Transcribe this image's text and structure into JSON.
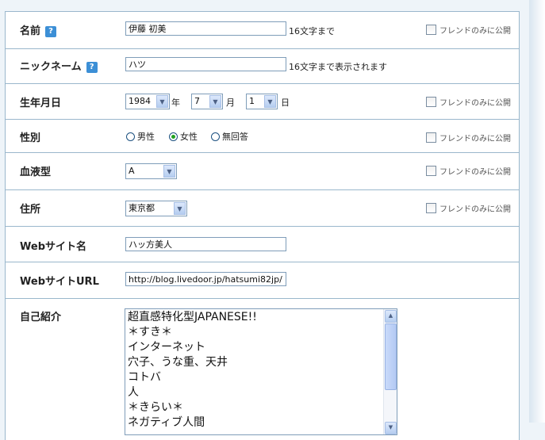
{
  "help_glyph": "?",
  "public_only": "フレンドのみに公開",
  "name": {
    "label": "名前",
    "value": "伊藤 初美",
    "note": "16文字まで"
  },
  "nickname": {
    "label": "ニックネーム",
    "value": "ハツ",
    "note": "16文字まで表示されます"
  },
  "birthday": {
    "label": "生年月日",
    "year": "1984",
    "year_unit": "年",
    "month": "7",
    "month_unit": "月",
    "day": "1",
    "day_unit": "日"
  },
  "gender": {
    "label": "性別",
    "options": [
      "男性",
      "女性",
      "無回答"
    ],
    "selected": "女性"
  },
  "blood_type": {
    "label": "血液型",
    "value": "A"
  },
  "address": {
    "label": "住所",
    "value": "東京都"
  },
  "website_name": {
    "label": "Webサイト名",
    "value": "ハッ方美人"
  },
  "website_url": {
    "label": "WebサイトURL",
    "value": "http://blog.livedoor.jp/hatsumi82jp/"
  },
  "intro": {
    "label": "自己紹介",
    "lines": [
      "超直感特化型JAPANESE!!",
      "＊すき＊",
      "インターネット",
      "穴子、うな重、天井",
      "コトバ",
      "人",
      "＊きらい＊",
      "ネガティブ人間"
    ]
  },
  "icons": {
    "help": "question-mark-icon",
    "checkbox": "checkbox-icon",
    "dropdown": "chevron-down-icon",
    "scroll_up": "scroll-up-icon",
    "scroll_down": "scroll-down-icon"
  },
  "colors": {
    "border": "#9ab7cc",
    "help_badge": "#3c8fd6",
    "background": "#eef4f9",
    "radio_selected": "#21a121"
  }
}
